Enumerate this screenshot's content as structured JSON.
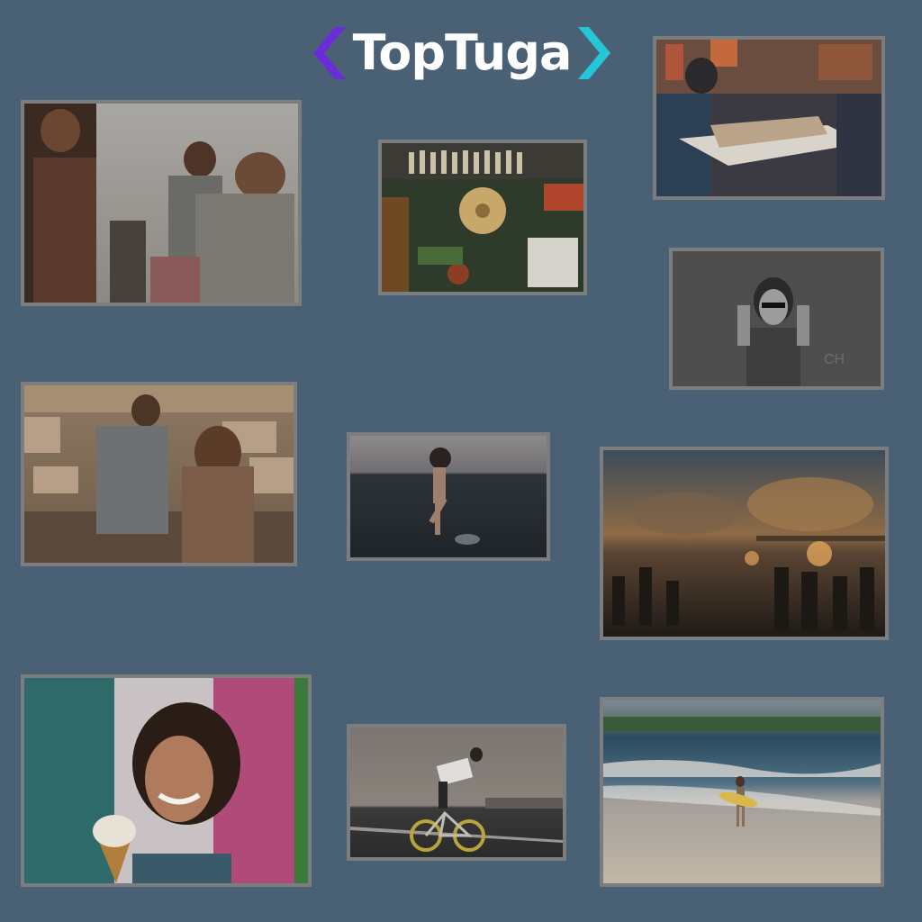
{
  "brand": {
    "name": "TopTuga",
    "colors": {
      "left_chevron": "#6a2bd9",
      "right_chevron": "#22c7d8",
      "text": "#ffffff",
      "background": "#4a6075",
      "frame": "#7b7d7f"
    }
  },
  "photos": [
    {
      "name": "friends-party-photo",
      "subject": "group-celebrating"
    },
    {
      "name": "street-food-stall-photo",
      "subject": "grilled-fish-market"
    },
    {
      "name": "night-market-snack-photo",
      "subject": "takeaway-food-tray"
    },
    {
      "name": "woman-graffiti-wall-photo",
      "subject": "laughing-woman-sunglasses"
    },
    {
      "name": "couple-city-view-photo",
      "subject": "couple-overlooking-city"
    },
    {
      "name": "woman-wading-sea-photo",
      "subject": "woman-in-ocean"
    },
    {
      "name": "evening-market-photo",
      "subject": "crowd-at-dusk-market"
    },
    {
      "name": "ice-cream-woman-photo",
      "subject": "smiling-woman-ice-cream"
    },
    {
      "name": "cyclist-road-photo",
      "subject": "man-on-fixed-gear-bike"
    },
    {
      "name": "surfer-beach-photo",
      "subject": "surfer-walking-shore"
    }
  ]
}
